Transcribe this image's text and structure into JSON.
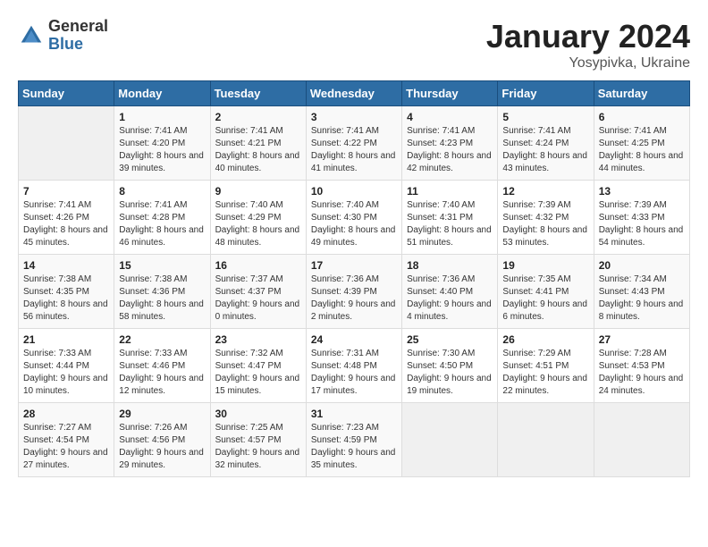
{
  "header": {
    "logo_general": "General",
    "logo_blue": "Blue",
    "month": "January 2024",
    "location": "Yosypivka, Ukraine"
  },
  "days_of_week": [
    "Sunday",
    "Monday",
    "Tuesday",
    "Wednesday",
    "Thursday",
    "Friday",
    "Saturday"
  ],
  "weeks": [
    [
      {
        "day": "",
        "sunrise": "",
        "sunset": "",
        "daylight": ""
      },
      {
        "day": "1",
        "sunrise": "Sunrise: 7:41 AM",
        "sunset": "Sunset: 4:20 PM",
        "daylight": "Daylight: 8 hours and 39 minutes."
      },
      {
        "day": "2",
        "sunrise": "Sunrise: 7:41 AM",
        "sunset": "Sunset: 4:21 PM",
        "daylight": "Daylight: 8 hours and 40 minutes."
      },
      {
        "day": "3",
        "sunrise": "Sunrise: 7:41 AM",
        "sunset": "Sunset: 4:22 PM",
        "daylight": "Daylight: 8 hours and 41 minutes."
      },
      {
        "day": "4",
        "sunrise": "Sunrise: 7:41 AM",
        "sunset": "Sunset: 4:23 PM",
        "daylight": "Daylight: 8 hours and 42 minutes."
      },
      {
        "day": "5",
        "sunrise": "Sunrise: 7:41 AM",
        "sunset": "Sunset: 4:24 PM",
        "daylight": "Daylight: 8 hours and 43 minutes."
      },
      {
        "day": "6",
        "sunrise": "Sunrise: 7:41 AM",
        "sunset": "Sunset: 4:25 PM",
        "daylight": "Daylight: 8 hours and 44 minutes."
      }
    ],
    [
      {
        "day": "7",
        "sunrise": "Sunrise: 7:41 AM",
        "sunset": "Sunset: 4:26 PM",
        "daylight": "Daylight: 8 hours and 45 minutes."
      },
      {
        "day": "8",
        "sunrise": "Sunrise: 7:41 AM",
        "sunset": "Sunset: 4:28 PM",
        "daylight": "Daylight: 8 hours and 46 minutes."
      },
      {
        "day": "9",
        "sunrise": "Sunrise: 7:40 AM",
        "sunset": "Sunset: 4:29 PM",
        "daylight": "Daylight: 8 hours and 48 minutes."
      },
      {
        "day": "10",
        "sunrise": "Sunrise: 7:40 AM",
        "sunset": "Sunset: 4:30 PM",
        "daylight": "Daylight: 8 hours and 49 minutes."
      },
      {
        "day": "11",
        "sunrise": "Sunrise: 7:40 AM",
        "sunset": "Sunset: 4:31 PM",
        "daylight": "Daylight: 8 hours and 51 minutes."
      },
      {
        "day": "12",
        "sunrise": "Sunrise: 7:39 AM",
        "sunset": "Sunset: 4:32 PM",
        "daylight": "Daylight: 8 hours and 53 minutes."
      },
      {
        "day": "13",
        "sunrise": "Sunrise: 7:39 AM",
        "sunset": "Sunset: 4:33 PM",
        "daylight": "Daylight: 8 hours and 54 minutes."
      }
    ],
    [
      {
        "day": "14",
        "sunrise": "Sunrise: 7:38 AM",
        "sunset": "Sunset: 4:35 PM",
        "daylight": "Daylight: 8 hours and 56 minutes."
      },
      {
        "day": "15",
        "sunrise": "Sunrise: 7:38 AM",
        "sunset": "Sunset: 4:36 PM",
        "daylight": "Daylight: 8 hours and 58 minutes."
      },
      {
        "day": "16",
        "sunrise": "Sunrise: 7:37 AM",
        "sunset": "Sunset: 4:37 PM",
        "daylight": "Daylight: 9 hours and 0 minutes."
      },
      {
        "day": "17",
        "sunrise": "Sunrise: 7:36 AM",
        "sunset": "Sunset: 4:39 PM",
        "daylight": "Daylight: 9 hours and 2 minutes."
      },
      {
        "day": "18",
        "sunrise": "Sunrise: 7:36 AM",
        "sunset": "Sunset: 4:40 PM",
        "daylight": "Daylight: 9 hours and 4 minutes."
      },
      {
        "day": "19",
        "sunrise": "Sunrise: 7:35 AM",
        "sunset": "Sunset: 4:41 PM",
        "daylight": "Daylight: 9 hours and 6 minutes."
      },
      {
        "day": "20",
        "sunrise": "Sunrise: 7:34 AM",
        "sunset": "Sunset: 4:43 PM",
        "daylight": "Daylight: 9 hours and 8 minutes."
      }
    ],
    [
      {
        "day": "21",
        "sunrise": "Sunrise: 7:33 AM",
        "sunset": "Sunset: 4:44 PM",
        "daylight": "Daylight: 9 hours and 10 minutes."
      },
      {
        "day": "22",
        "sunrise": "Sunrise: 7:33 AM",
        "sunset": "Sunset: 4:46 PM",
        "daylight": "Daylight: 9 hours and 12 minutes."
      },
      {
        "day": "23",
        "sunrise": "Sunrise: 7:32 AM",
        "sunset": "Sunset: 4:47 PM",
        "daylight": "Daylight: 9 hours and 15 minutes."
      },
      {
        "day": "24",
        "sunrise": "Sunrise: 7:31 AM",
        "sunset": "Sunset: 4:48 PM",
        "daylight": "Daylight: 9 hours and 17 minutes."
      },
      {
        "day": "25",
        "sunrise": "Sunrise: 7:30 AM",
        "sunset": "Sunset: 4:50 PM",
        "daylight": "Daylight: 9 hours and 19 minutes."
      },
      {
        "day": "26",
        "sunrise": "Sunrise: 7:29 AM",
        "sunset": "Sunset: 4:51 PM",
        "daylight": "Daylight: 9 hours and 22 minutes."
      },
      {
        "day": "27",
        "sunrise": "Sunrise: 7:28 AM",
        "sunset": "Sunset: 4:53 PM",
        "daylight": "Daylight: 9 hours and 24 minutes."
      }
    ],
    [
      {
        "day": "28",
        "sunrise": "Sunrise: 7:27 AM",
        "sunset": "Sunset: 4:54 PM",
        "daylight": "Daylight: 9 hours and 27 minutes."
      },
      {
        "day": "29",
        "sunrise": "Sunrise: 7:26 AM",
        "sunset": "Sunset: 4:56 PM",
        "daylight": "Daylight: 9 hours and 29 minutes."
      },
      {
        "day": "30",
        "sunrise": "Sunrise: 7:25 AM",
        "sunset": "Sunset: 4:57 PM",
        "daylight": "Daylight: 9 hours and 32 minutes."
      },
      {
        "day": "31",
        "sunrise": "Sunrise: 7:23 AM",
        "sunset": "Sunset: 4:59 PM",
        "daylight": "Daylight: 9 hours and 35 minutes."
      },
      {
        "day": "",
        "sunrise": "",
        "sunset": "",
        "daylight": ""
      },
      {
        "day": "",
        "sunrise": "",
        "sunset": "",
        "daylight": ""
      },
      {
        "day": "",
        "sunrise": "",
        "sunset": "",
        "daylight": ""
      }
    ]
  ]
}
